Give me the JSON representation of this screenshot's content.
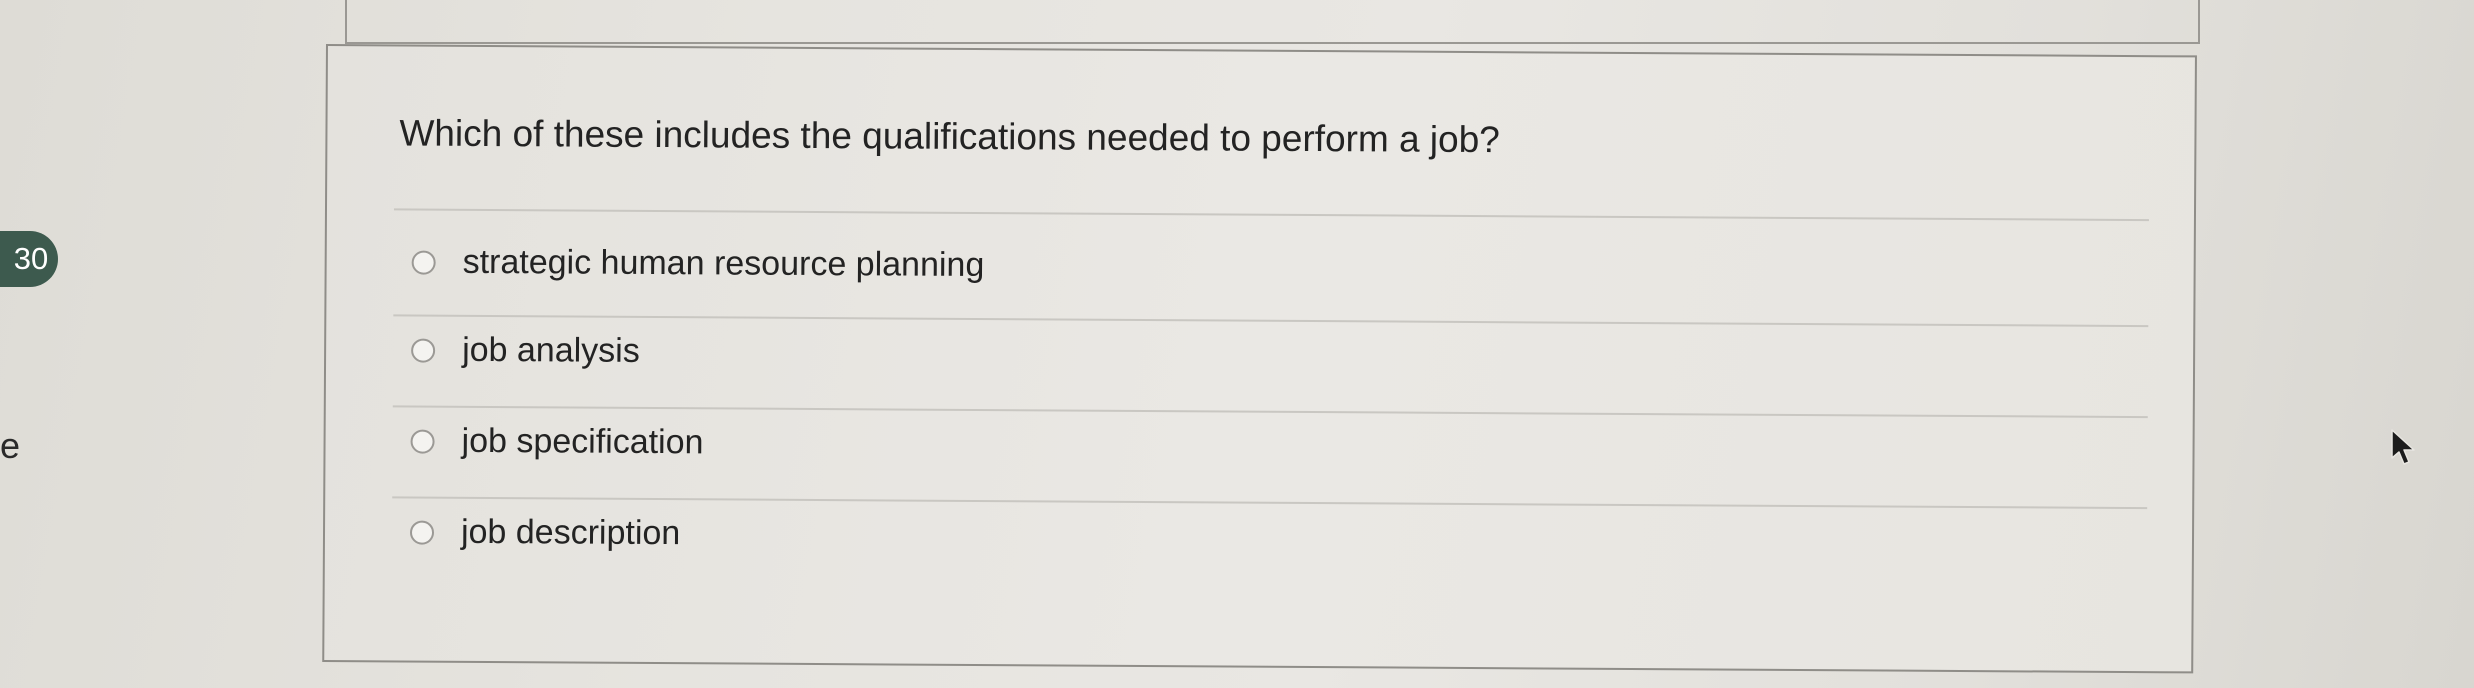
{
  "question": {
    "number": "30",
    "text": "Which of these includes the qualifications needed to perform a job?",
    "options": [
      {
        "label": "strategic human resource planning",
        "selected": false
      },
      {
        "label": "job analysis",
        "selected": false
      },
      {
        "label": "job specification",
        "selected": false
      },
      {
        "label": "job description",
        "selected": false
      }
    ]
  },
  "side_text": "e",
  "icons": {
    "cursor": "mouse-pointer-icon",
    "radio": "radio-unchecked-icon"
  },
  "colors": {
    "badge": "#3d5a4e",
    "border": "#8f8d88"
  }
}
